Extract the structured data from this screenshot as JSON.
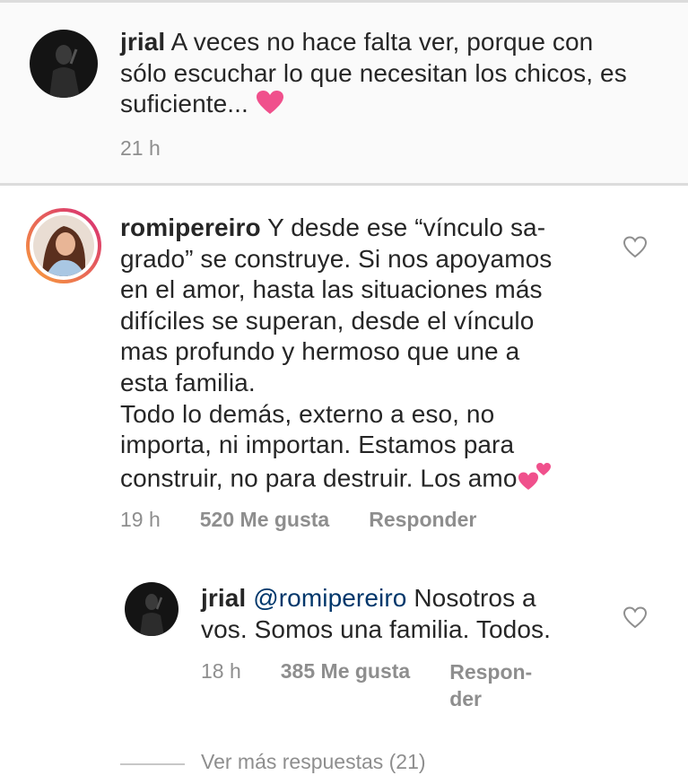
{
  "comments": [
    {
      "username": "jrial",
      "text": "A veces no hace falta ver, porque con sólo escuchar lo que necesitan los chicos, es suficiente...",
      "time": "21 h"
    },
    {
      "username": "romipereiro",
      "text_lines": [
        "Y desde ese “vínculo sa-",
        "grado” se construye. Si nos apoyamos",
        "en el amor, hasta las situaciones más",
        "difíciles se superan, desde el vínculo",
        "mas profundo y hermoso que une a",
        "esta familia.",
        "Todo lo demás, externo a eso, no",
        "importa, ni importan. Estamos para",
        "construir, no para destruir. Los amo"
      ],
      "time": "19 h",
      "likes": "520 Me gusta",
      "reply": "Responder"
    }
  ],
  "reply": {
    "username": "jrial",
    "mention": "@romipereiro",
    "text_line1": "Nosotros a",
    "text_line2": "vos. Somos una familia. Todos.",
    "time": "18 h",
    "likes": "385 Me gusta",
    "reply_line1": "Respon-",
    "reply_line2": "der"
  },
  "view_more": "Ver más respuestas (21)",
  "colors": {
    "heart_emoji": "#f0508c",
    "story_ring_start": "#f9a13a",
    "story_ring_end": "#d62976"
  }
}
